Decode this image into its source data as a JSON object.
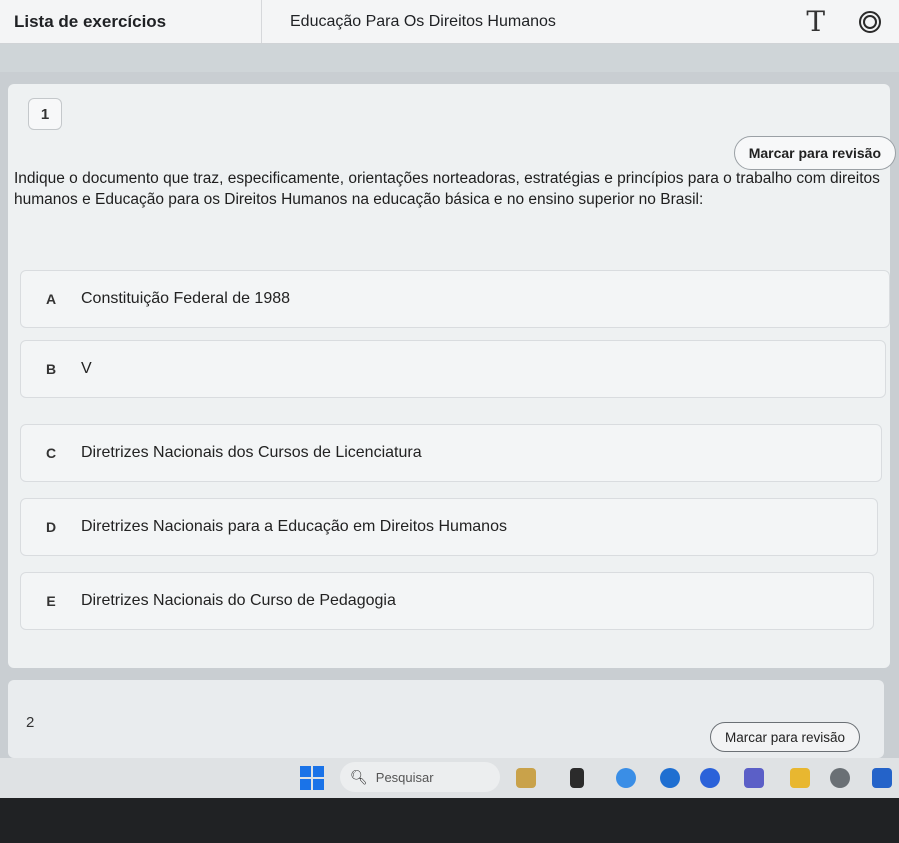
{
  "header": {
    "title": "Lista de exercícios",
    "course": "Educação Para Os Direitos Humanos",
    "text_tool_glyph": "T"
  },
  "question1": {
    "number": "1",
    "review_label": "Marcar para revisão",
    "statement": "Indique o documento que traz, especificamente, orientações norteadoras, estratégias e princípios para o trabalho com direitos humanos e Educação para os Direitos Humanos na educação básica e no ensino superior no Brasil:",
    "options": [
      {
        "letter": "A",
        "text": "Constituição Federal de 1988"
      },
      {
        "letter": "B",
        "text": "V"
      },
      {
        "letter": "C",
        "text": "Diretrizes Nacionais dos Cursos de Licenciatura"
      },
      {
        "letter": "D",
        "text": "Diretrizes Nacionais para a Educação em Direitos Humanos"
      },
      {
        "letter": "E",
        "text": "Diretrizes Nacionais do Curso de Pedagogia"
      }
    ]
  },
  "question2": {
    "number": "2",
    "review_label": "Marcar para revisão"
  },
  "taskbar": {
    "search_placeholder": "Pesquisar",
    "search_glyph": "🔍︎",
    "colors": {
      "start": "#1a73e8"
    }
  }
}
